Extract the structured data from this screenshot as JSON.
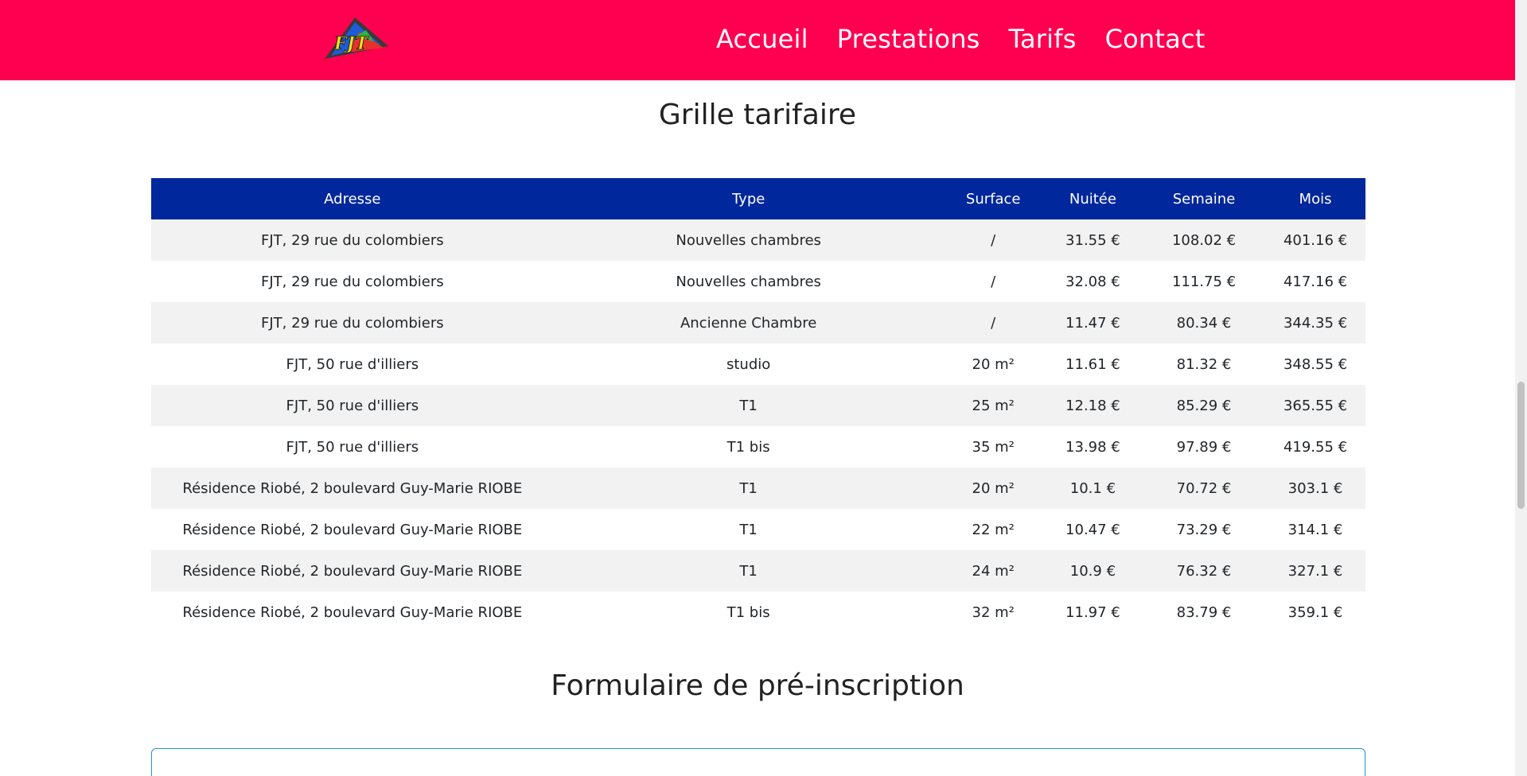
{
  "header": {
    "bg_color": "#ff0050",
    "logo_icon": "fjt-logo-icon",
    "logo_text": "FJT",
    "nav": [
      {
        "label": "Accueil"
      },
      {
        "label": "Prestations"
      },
      {
        "label": "Tarifs"
      },
      {
        "label": "Contact"
      }
    ]
  },
  "main": {
    "tarifs_title": "Grille tarifaire",
    "form_title": "Formulaire de pré-inscription",
    "table": {
      "header_color": "#00279b",
      "columns": [
        "Adresse",
        "Type",
        "Surface",
        "Nuitée",
        "Semaine",
        "Mois"
      ],
      "rows": [
        [
          "FJT, 29 rue du colombiers",
          "Nouvelles chambres",
          "/",
          "31.55 €",
          "108.02 €",
          "401.16 €"
        ],
        [
          "FJT, 29 rue du colombiers",
          "Nouvelles chambres",
          "/",
          "32.08 €",
          "111.75 €",
          "417.16 €"
        ],
        [
          "FJT, 29 rue du colombiers",
          "Ancienne Chambre",
          "/",
          "11.47 €",
          "80.34 €",
          "344.35 €"
        ],
        [
          "FJT, 50 rue d'illiers",
          "studio",
          "20 m²",
          "11.61 €",
          "81.32 €",
          "348.55 €"
        ],
        [
          "FJT, 50 rue d'illiers",
          "T1",
          "25 m²",
          "12.18 €",
          "85.29 €",
          "365.55 €"
        ],
        [
          "FJT, 50 rue d'illiers",
          "T1 bis",
          "35 m²",
          "13.98 €",
          "97.89 €",
          "419.55 €"
        ],
        [
          "Résidence Riobé, 2 boulevard Guy-Marie RIOBE",
          "T1",
          "20 m²",
          "10.1 €",
          "70.72 €",
          "303.1 €"
        ],
        [
          "Résidence Riobé, 2 boulevard Guy-Marie RIOBE",
          "T1",
          "22 m²",
          "10.47 €",
          "73.29 €",
          "314.1 €"
        ],
        [
          "Résidence Riobé, 2 boulevard Guy-Marie RIOBE",
          "T1",
          "24 m²",
          "10.9 €",
          "76.32 €",
          "327.1 €"
        ],
        [
          "Résidence Riobé, 2 boulevard Guy-Marie RIOBE",
          "T1 bis",
          "32 m²",
          "11.97 €",
          "83.79 €",
          "359.1 €"
        ]
      ]
    }
  }
}
